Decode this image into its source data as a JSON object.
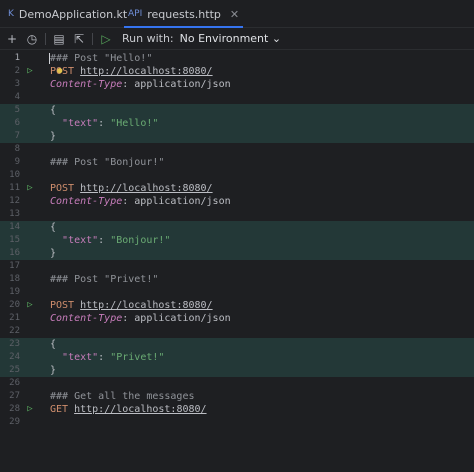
{
  "tabs": [
    {
      "icon": "K",
      "label": "DemoApplication.kt"
    },
    {
      "icon": "API",
      "label": "requests.http",
      "close": "✕"
    }
  ],
  "toolbar": {
    "add": "+",
    "history": "◷",
    "examples": "▤",
    "convert": "⇱",
    "run_all": "▷",
    "run_with_label": "Run with:",
    "environment": "No Environment",
    "env_chevron": "⌄"
  },
  "colors": {
    "accent": "#3574f0",
    "run": "#57a65b",
    "highlight": "#233837"
  },
  "editor": {
    "lines": [
      {
        "n": "1",
        "parts": [
          [
            "cm",
            "### Post \"Hello!\""
          ]
        ]
      },
      {
        "n": "2",
        "run": true,
        "parts": [
          [
            "kw",
            "POST"
          ],
          [
            "pl",
            " "
          ],
          [
            "url",
            "http://localhost:8080/"
          ]
        ]
      },
      {
        "n": "3",
        "parts": [
          [
            "hdr",
            "Content-Type"
          ],
          [
            "pl",
            ": application/json"
          ]
        ]
      },
      {
        "n": "4",
        "parts": []
      },
      {
        "n": "5",
        "hl": true,
        "parts": [
          [
            "pl",
            "{"
          ]
        ]
      },
      {
        "n": "6",
        "hl": true,
        "parts": [
          [
            "pl",
            "  "
          ],
          [
            "key",
            "\"text\""
          ],
          [
            "pl",
            ": "
          ],
          [
            "str",
            "\"Hello!\""
          ]
        ]
      },
      {
        "n": "7",
        "hl": true,
        "parts": [
          [
            "pl",
            "}"
          ]
        ]
      },
      {
        "n": "8",
        "parts": []
      },
      {
        "n": "9",
        "parts": [
          [
            "cm",
            "### Post \"Bonjour!\""
          ]
        ]
      },
      {
        "n": "10",
        "parts": []
      },
      {
        "n": "11",
        "run": true,
        "parts": [
          [
            "kw",
            "POST"
          ],
          [
            "pl",
            " "
          ],
          [
            "url",
            "http://localhost:8080/"
          ]
        ]
      },
      {
        "n": "12",
        "parts": [
          [
            "hdr",
            "Content-Type"
          ],
          [
            "pl",
            ": application/json"
          ]
        ]
      },
      {
        "n": "13",
        "parts": []
      },
      {
        "n": "14",
        "hl": true,
        "parts": [
          [
            "pl",
            "{"
          ]
        ]
      },
      {
        "n": "15",
        "hl": true,
        "parts": [
          [
            "pl",
            "  "
          ],
          [
            "key",
            "\"text\""
          ],
          [
            "pl",
            ": "
          ],
          [
            "str",
            "\"Bonjour!\""
          ]
        ]
      },
      {
        "n": "16",
        "hl": true,
        "parts": [
          [
            "pl",
            "}"
          ]
        ]
      },
      {
        "n": "17",
        "parts": []
      },
      {
        "n": "18",
        "parts": [
          [
            "cm",
            "### Post \"Privet!\""
          ]
        ]
      },
      {
        "n": "19",
        "parts": []
      },
      {
        "n": "20",
        "run": true,
        "parts": [
          [
            "kw",
            "POST"
          ],
          [
            "pl",
            " "
          ],
          [
            "url",
            "http://localhost:8080/"
          ]
        ]
      },
      {
        "n": "21",
        "parts": [
          [
            "hdr",
            "Content-Type"
          ],
          [
            "pl",
            ": application/json"
          ]
        ]
      },
      {
        "n": "22",
        "parts": []
      },
      {
        "n": "23",
        "hl": true,
        "parts": [
          [
            "pl",
            "{"
          ]
        ]
      },
      {
        "n": "24",
        "hl": true,
        "parts": [
          [
            "pl",
            "  "
          ],
          [
            "key",
            "\"text\""
          ],
          [
            "pl",
            ": "
          ],
          [
            "str",
            "\"Privet!\""
          ]
        ]
      },
      {
        "n": "25",
        "hl": true,
        "parts": [
          [
            "pl",
            "}"
          ]
        ]
      },
      {
        "n": "26",
        "parts": []
      },
      {
        "n": "27",
        "parts": [
          [
            "cm",
            "### Get all the messages"
          ]
        ]
      },
      {
        "n": "28",
        "run": true,
        "parts": [
          [
            "kw",
            "GET"
          ],
          [
            "pl",
            " "
          ],
          [
            "url",
            "http://localhost:8080/"
          ]
        ]
      },
      {
        "n": "29",
        "parts": []
      }
    ]
  }
}
